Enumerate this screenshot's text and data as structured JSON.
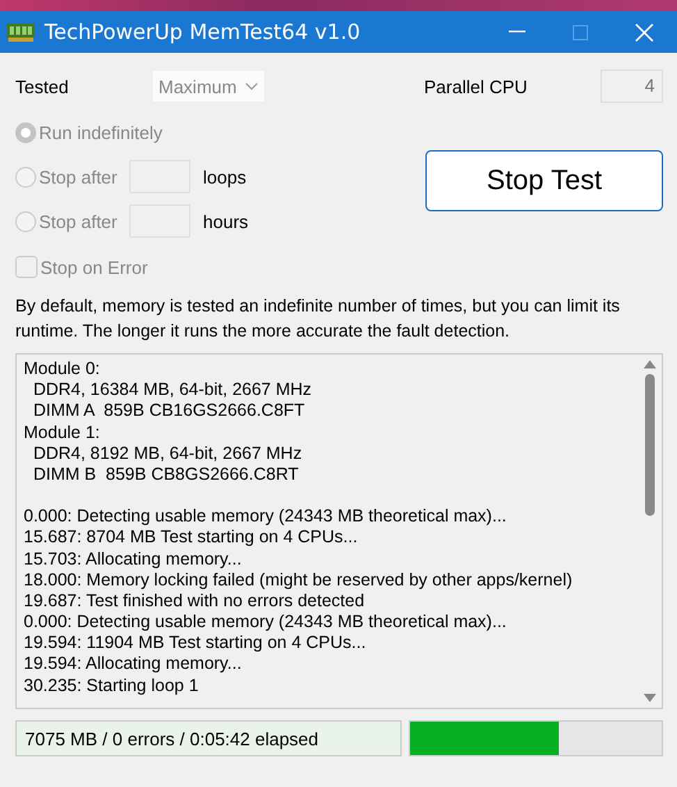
{
  "window": {
    "title": "TechPowerUp MemTest64 v1.0"
  },
  "tested": {
    "label": "Tested",
    "value": "Maximum",
    "disabled": true
  },
  "parallel_cpu": {
    "label": "Parallel CPU",
    "value": "4",
    "disabled": true
  },
  "run_options": [
    {
      "label": "Run indefinitely",
      "selected": true,
      "disabled": true
    },
    {
      "label": "Stop after",
      "selected": false,
      "disabled": true,
      "unit": "loops"
    },
    {
      "label": "Stop after",
      "selected": false,
      "disabled": true,
      "unit": "hours"
    }
  ],
  "stop_button": {
    "label": "Stop Test"
  },
  "stop_on_error": {
    "label": "Stop on Error",
    "checked": false,
    "disabled": true
  },
  "description": "By default, memory is tested an indefinite number of times, but you can limit its runtime. The longer it runs the more accurate the fault detection.",
  "log": [
    [
      "Module 0:",
      "  DDR4, 16384 MB, 64-bit, 2667 MHz",
      "  DIMM A  859B CB16GS2666.C8FT",
      "Module 1:",
      "  DDR4, 8192 MB, 64-bit, 2667 MHz",
      "  DIMM B  859B CB8GS2666.C8RT"
    ],
    [
      "0.000: Detecting usable memory (24343 MB theoretical max)...",
      "15.687: 8704 MB Test starting on 4 CPUs...",
      "15.703: Allocating memory...",
      "18.000: Memory locking failed (might be reserved by other apps/kernel)",
      "19.687: Test finished with no errors detected",
      "0.000: Detecting usable memory (24343 MB theoretical max)...",
      "19.594: 11904 MB Test starting on 4 CPUs...",
      "19.594: Allocating memory...",
      "30.235: Starting loop 1"
    ]
  ],
  "status_bar": {
    "text": "7075 MB / 0 errors / 0:05:42 elapsed",
    "level": 0.59
  }
}
